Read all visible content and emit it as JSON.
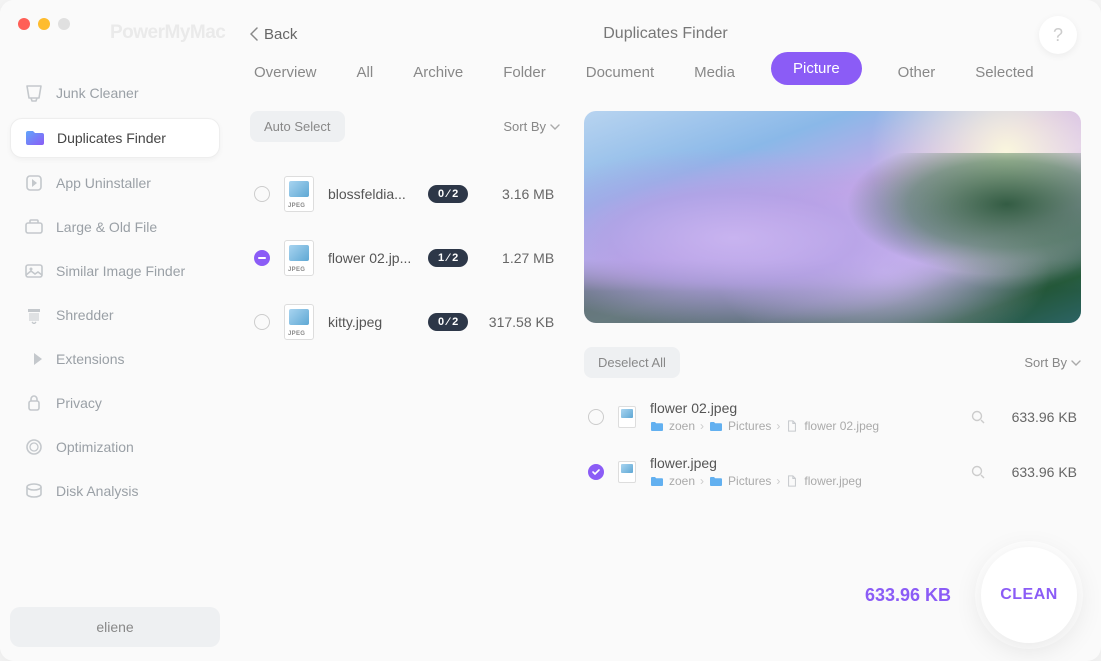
{
  "brand": "PowerMyMac",
  "back": "Back",
  "title": "Duplicates Finder",
  "help": "?",
  "sidebar": {
    "items": [
      {
        "label": "Junk Cleaner"
      },
      {
        "label": "Duplicates Finder"
      },
      {
        "label": "App Uninstaller"
      },
      {
        "label": "Large & Old File"
      },
      {
        "label": "Similar Image Finder"
      },
      {
        "label": "Shredder"
      },
      {
        "label": "Extensions"
      },
      {
        "label": "Privacy"
      },
      {
        "label": "Optimization"
      },
      {
        "label": "Disk Analysis"
      }
    ],
    "user": "eliene"
  },
  "tabs": [
    "Overview",
    "All",
    "Archive",
    "Folder",
    "Document",
    "Media",
    "Picture",
    "Other",
    "Selected"
  ],
  "left": {
    "auto": "Auto Select",
    "sort": "Sort By",
    "files": [
      {
        "name": "blossfeldia...",
        "badge": "0 ⁄ 2",
        "size": "3.16 MB",
        "state": "empty"
      },
      {
        "name": "flower 02.jp...",
        "badge": "1 ⁄ 2",
        "size": "1.27 MB",
        "state": "semi"
      },
      {
        "name": "kitty.jpeg",
        "badge": "0 ⁄ 2",
        "size": "317.58 KB",
        "state": "empty"
      }
    ]
  },
  "right": {
    "deselect": "Deselect All",
    "sort": "Sort By",
    "dups": [
      {
        "name": "flower 02.jpeg",
        "path": [
          "zoen",
          "Pictures",
          "flower 02.jpeg"
        ],
        "size": "633.96 KB",
        "checked": false
      },
      {
        "name": "flower.jpeg",
        "path": [
          "zoen",
          "Pictures",
          "flower.jpeg"
        ],
        "size": "633.96 KB",
        "checked": true
      }
    ]
  },
  "footer": {
    "total": "633.96 KB",
    "clean": "CLEAN"
  },
  "thumb_tag": "JPEG"
}
